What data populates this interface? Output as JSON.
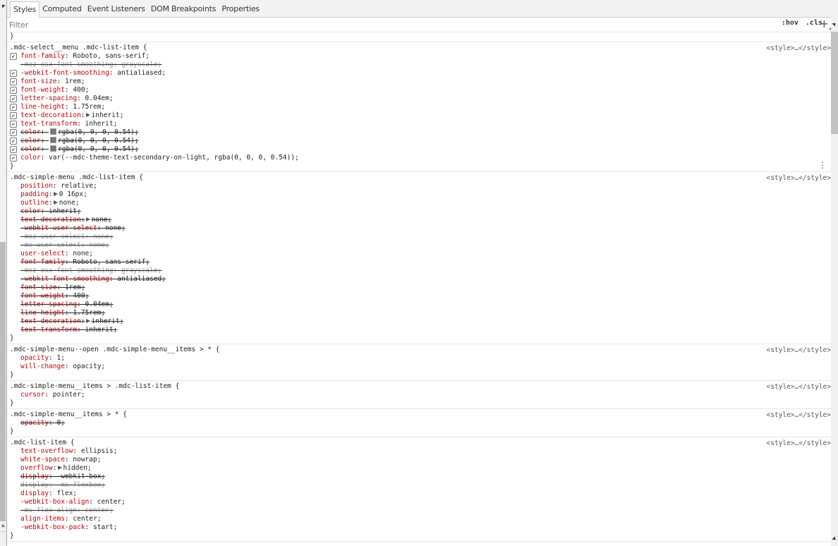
{
  "tabs": [
    {
      "label": "Styles",
      "active": true
    },
    {
      "label": "Computed"
    },
    {
      "label": "Event Listeners"
    },
    {
      "label": "DOM Breakpoints"
    },
    {
      "label": "Properties"
    }
  ],
  "toolbar": {
    "filter_placeholder": "Filter",
    "hov_label": ":hov",
    "cls_label": ".cls",
    "add_label": "+"
  },
  "closing_brace": "}",
  "source_label": "<style>…</style>",
  "rules": [
    {
      "selector": ".mdc-select__menu .mdc-list-item {",
      "props": [
        {
          "name": "font-family",
          "value": "Roboto, sans-serif;",
          "checkbox": true
        },
        {
          "name": "-moz-osx-font-smoothing",
          "value": "grayscale;",
          "struck": true,
          "grey": true
        },
        {
          "name": "-webkit-font-smoothing",
          "value": "antialiased;",
          "checkbox": true
        },
        {
          "name": "font-size",
          "value": "1rem;",
          "checkbox": true
        },
        {
          "name": "font-weight",
          "value": "400;",
          "checkbox": true
        },
        {
          "name": "letter-spacing",
          "value": "0.04em;",
          "checkbox": true
        },
        {
          "name": "line-height",
          "value": "1.75rem;",
          "checkbox": true
        },
        {
          "name": "text-decoration",
          "value": "inherit;",
          "checkbox": true,
          "expand": true
        },
        {
          "name": "text-transform",
          "value": "inherit;",
          "checkbox": true
        },
        {
          "name": "color",
          "value": "rgba(0, 0, 0, 0.54);",
          "checkbox": true,
          "struck": true,
          "swatch": true
        },
        {
          "name": "color",
          "value": "rgba(0, 0, 0, 0.54);",
          "checkbox": true,
          "struck": true,
          "swatch": true
        },
        {
          "name": "color",
          "value": "rgba(0, 0, 0, 0.54);",
          "checkbox": true,
          "struck": true,
          "swatch": true
        },
        {
          "name": "color",
          "value": "var(--mdc-theme-text-secondary-on-light, rgba(0, 0, 0, 0.54));",
          "checkbox": true
        }
      ]
    },
    {
      "selector": ".mdc-simple-menu .mdc-list-item {",
      "props": [
        {
          "name": "position",
          "value": "relative;"
        },
        {
          "name": "padding",
          "value": "0 16px;",
          "expand": true
        },
        {
          "name": "outline",
          "value": "none;",
          "expand": true
        },
        {
          "name": "color",
          "value": "inherit;",
          "struck": true
        },
        {
          "name": "text-decoration",
          "value": "none;",
          "struck": true,
          "expand": true
        },
        {
          "name": "-webkit-user-select",
          "value": "none;",
          "struck": true
        },
        {
          "name": "-moz-user-select",
          "value": "none;",
          "struck": true,
          "grey": true
        },
        {
          "name": "-ms-user-select",
          "value": "none;",
          "struck": true,
          "grey": true
        },
        {
          "name": "user-select",
          "value": "none;"
        },
        {
          "name": "font-family",
          "value": "Roboto, sans-serif;",
          "struck": true
        },
        {
          "name": "-moz-osx-font-smoothing",
          "value": "grayscale;",
          "struck": true,
          "grey": true
        },
        {
          "name": "-webkit-font-smoothing",
          "value": "antialiased;",
          "struck": true
        },
        {
          "name": "font-size",
          "value": "1rem;",
          "struck": true
        },
        {
          "name": "font-weight",
          "value": "400;",
          "struck": true
        },
        {
          "name": "letter-spacing",
          "value": "0.04em;",
          "struck": true
        },
        {
          "name": "line-height",
          "value": "1.75rem;",
          "struck": true
        },
        {
          "name": "text-decoration",
          "value": "inherit;",
          "struck": true,
          "expand": true
        },
        {
          "name": "text-transform",
          "value": "inherit;",
          "struck": true
        }
      ]
    },
    {
      "selector": ".mdc-simple-menu--open .mdc-simple-menu__items > * {",
      "props": [
        {
          "name": "opacity",
          "value": "1;"
        },
        {
          "name": "will-change",
          "value": "opacity;"
        }
      ]
    },
    {
      "selector": ".mdc-simple-menu__items > .mdc-list-item {",
      "props": [
        {
          "name": "cursor",
          "value": "pointer;"
        }
      ]
    },
    {
      "selector": ".mdc-simple-menu__items > * {",
      "props": [
        {
          "name": "opacity",
          "value": "0;",
          "struck": true
        }
      ]
    },
    {
      "selector": ".mdc-list-item {",
      "props": [
        {
          "name": "text-overflow",
          "value": "ellipsis;"
        },
        {
          "name": "white-space",
          "value": "nowrap;"
        },
        {
          "name": "overflow",
          "value": "hidden;",
          "expand": true
        },
        {
          "name": "display",
          "value": "-webkit-box;",
          "struck": true
        },
        {
          "name": "display",
          "value": "-ms-flexbox;",
          "struck": true,
          "grey": true
        },
        {
          "name": "display",
          "value": "flex;"
        },
        {
          "name": "-webkit-box-align",
          "value": "center;"
        },
        {
          "name": "-ms-flex-align",
          "value": "center;",
          "struck": true,
          "grey": true
        },
        {
          "name": "align-items",
          "value": "center;"
        },
        {
          "name": "-webkit-box-pack",
          "value": "start;"
        }
      ]
    }
  ]
}
